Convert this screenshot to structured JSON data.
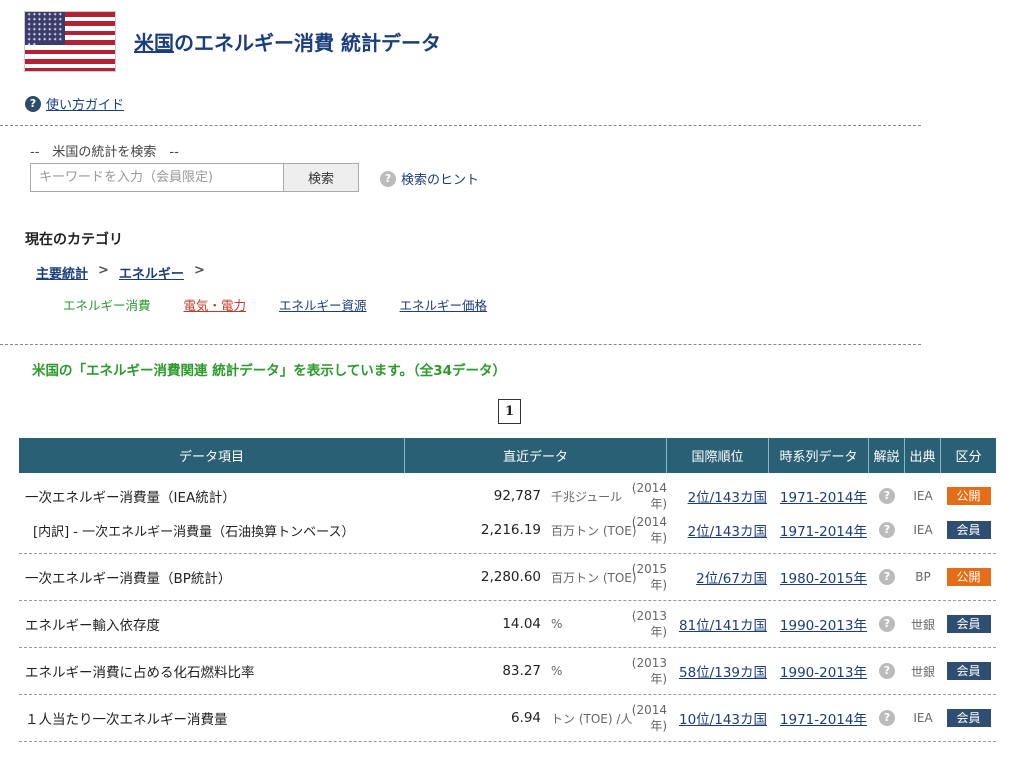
{
  "header": {
    "title_link": "米国",
    "title_rest": "のエネルギー消費 統計データ"
  },
  "guide_link": "使い方ガイド",
  "search": {
    "heading": "--　米国の統計を検索　--",
    "placeholder": "キーワードを入力（会員限定)",
    "button": "検索",
    "hint": "検索のヒント"
  },
  "category": {
    "heading": "現在のカテゴリ",
    "breadcrumb": [
      "主要統計",
      "エネルギー"
    ],
    "separator": ">",
    "subcategories": [
      "エネルギー消費",
      "電気・電力",
      "エネルギー資源",
      "エネルギー価格"
    ]
  },
  "showing_text": "米国の「エネルギー消費関連 統計データ」を表示しています。（全34データ）",
  "pager": {
    "current": "1"
  },
  "table": {
    "headers": [
      "データ項目",
      "直近データ",
      "国際順位",
      "時系列データ",
      "解説",
      "出典",
      "区分"
    ],
    "groups": [
      {
        "rows": [
          {
            "name": "一次エネルギー消費量（IEA統計）",
            "value": "92,787",
            "unit": "千兆ジュール",
            "year": "(2014年)",
            "rank": "2位/143カ国",
            "series": "1971-2014年",
            "source": "IEA",
            "kubun": "公開"
          },
          {
            "name": "[内訳] - 一次エネルギー消費量（石油換算トンベース）",
            "value": "2,216.19",
            "unit": "百万トン (TOE)",
            "year": "(2014年)",
            "rank": "2位/143カ国",
            "series": "1971-2014年",
            "source": "IEA",
            "kubun": "会員"
          }
        ]
      },
      {
        "rows": [
          {
            "name": "一次エネルギー消費量（BP統計）",
            "value": "2,280.60",
            "unit": "百万トン (TOE)",
            "year": "(2015年)",
            "rank": "2位/67カ国",
            "series": "1980-2015年",
            "source": "BP",
            "kubun": "公開"
          }
        ]
      },
      {
        "rows": [
          {
            "name": "エネルギー輸入依存度",
            "value": "14.04",
            "unit": "%",
            "year": "(2013年)",
            "rank": "81位/141カ国",
            "series": "1990-2013年",
            "source": "世銀",
            "kubun": "会員"
          }
        ]
      },
      {
        "rows": [
          {
            "name": "エネルギー消費に占める化石燃料比率",
            "value": "83.27",
            "unit": "%",
            "year": "(2013年)",
            "rank": "58位/139カ国",
            "series": "1990-2013年",
            "source": "世銀",
            "kubun": "会員"
          }
        ]
      },
      {
        "rows": [
          {
            "name": "１人当たり一次エネルギー消費量",
            "value": "6.94",
            "unit": "トン (TOE) /人",
            "year": "(2014年)",
            "rank": "10位/143カ国",
            "series": "1971-2014年",
            "source": "IEA",
            "kubun": "会員"
          }
        ]
      }
    ]
  },
  "colors": {
    "header_bg": "#2a6075",
    "accent_green": "#2b9a2b",
    "link": "#1a3d7c",
    "badge_public": "#e66d17",
    "badge_member": "#2e4e72"
  }
}
